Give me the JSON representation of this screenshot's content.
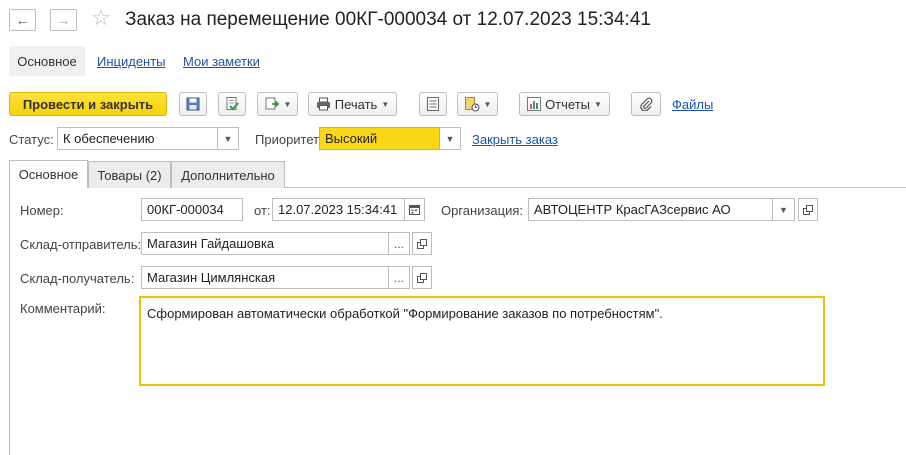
{
  "window": {
    "title": "Заказ на перемещение 00КГ-000034 от 12.07.2023 15:34:41"
  },
  "nav": {
    "tabs": [
      {
        "label": "Основное"
      },
      {
        "label": "Инциденты"
      },
      {
        "label": "Мои заметки"
      }
    ]
  },
  "toolbar": {
    "post_close_label": "Провести и закрыть",
    "print_label": "Печать",
    "reports_label": "Отчеты",
    "files_label": "Файлы"
  },
  "status_row": {
    "status_label": "Статус:",
    "status_value": "К обеспечению",
    "priority_label": "Приоритет:",
    "priority_value": "Высокий",
    "priority_color": "#f7d716",
    "close_order_label": "Закрыть заказ"
  },
  "content_tabs": [
    {
      "label": "Основное"
    },
    {
      "label": "Товары (2)"
    },
    {
      "label": "Дополнительно"
    }
  ],
  "form": {
    "number_label": "Номер:",
    "number_value": "00КГ-000034",
    "date_label": "от:",
    "date_value": "12.07.2023 15:34:41",
    "org_label": "Организация:",
    "org_value": "АВТОЦЕНТР КрасГАЗсервис АО",
    "sender_label": "Склад-отправитель:",
    "sender_value": "Магазин Гайдашовка",
    "receiver_label": "Склад-получатель:",
    "receiver_value": "Магазин Цимлянская",
    "comment_label": "Комментарий:",
    "comment_value": "Сформирован автоматически обработкой \"Формирование заказов по потребностям\".",
    "ellipsis": "..."
  },
  "colors": {
    "accent": "#f6d20a",
    "link": "#1a53a8",
    "focus": "#e6c400"
  }
}
